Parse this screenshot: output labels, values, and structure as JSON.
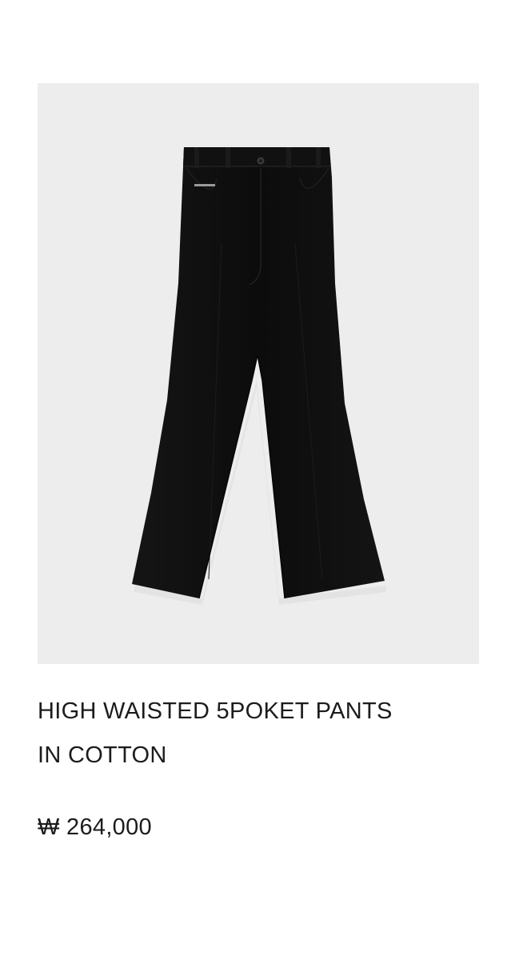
{
  "product": {
    "image": {
      "depicts": "black-wide-leg-pants",
      "background_color": "#ededed",
      "garment_color": "#0f0f0f"
    },
    "title_lines": [
      "HIGH WAISTED 5POKET PANTS",
      "IN COTTON"
    ],
    "price": "₩ 264,000"
  }
}
